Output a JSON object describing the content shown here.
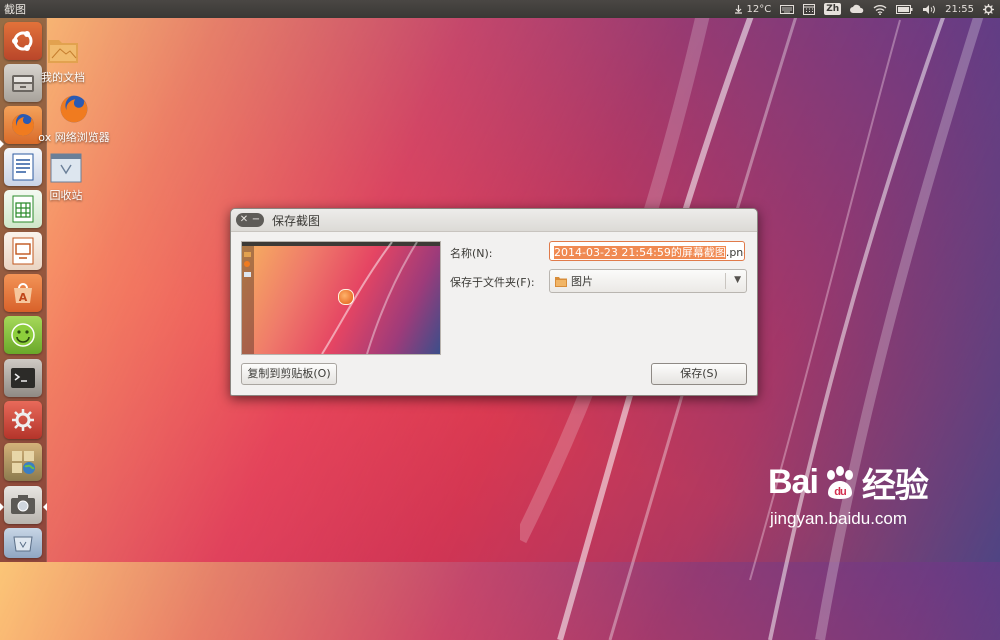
{
  "top_panel": {
    "app_title": "截图",
    "weather": "12°C",
    "input_method": "Zh",
    "time": "21:55"
  },
  "launcher": {
    "items": [
      {
        "name": "ubuntu-dash-icon"
      },
      {
        "name": "file-manager-icon"
      },
      {
        "name": "firefox-icon"
      },
      {
        "name": "libreoffice-writer-icon"
      },
      {
        "name": "libreoffice-calc-icon"
      },
      {
        "name": "libreoffice-impress-icon"
      },
      {
        "name": "software-center-icon"
      },
      {
        "name": "ubuntu-one-icon"
      },
      {
        "name": "terminal-icon"
      },
      {
        "name": "system-settings-icon"
      },
      {
        "name": "workspace-switcher-icon"
      },
      {
        "name": "screenshot-icon"
      },
      {
        "name": "trash-icon"
      }
    ]
  },
  "desktop": {
    "icons": [
      {
        "label": "我的文档"
      },
      {
        "label": "ox 网络浏览器"
      },
      {
        "label": "回收站"
      }
    ]
  },
  "dialog": {
    "title": "保存截图",
    "name_label": "名称(N):",
    "name_value_selected": "2014-03-23 21:54:59的屏幕截图",
    "name_value_ext": ".png",
    "folder_label": "保存于文件夹(F):",
    "folder_value": "图片",
    "copy_button": "复制到剪贴板(O)",
    "save_button": "保存(S)"
  },
  "watermark": {
    "brand": "Bai",
    "brand_suffix": "经验",
    "url": "jingyan.baidu.com"
  },
  "colors": {
    "accent": "#f08a52",
    "panel": "#3c3b37"
  }
}
